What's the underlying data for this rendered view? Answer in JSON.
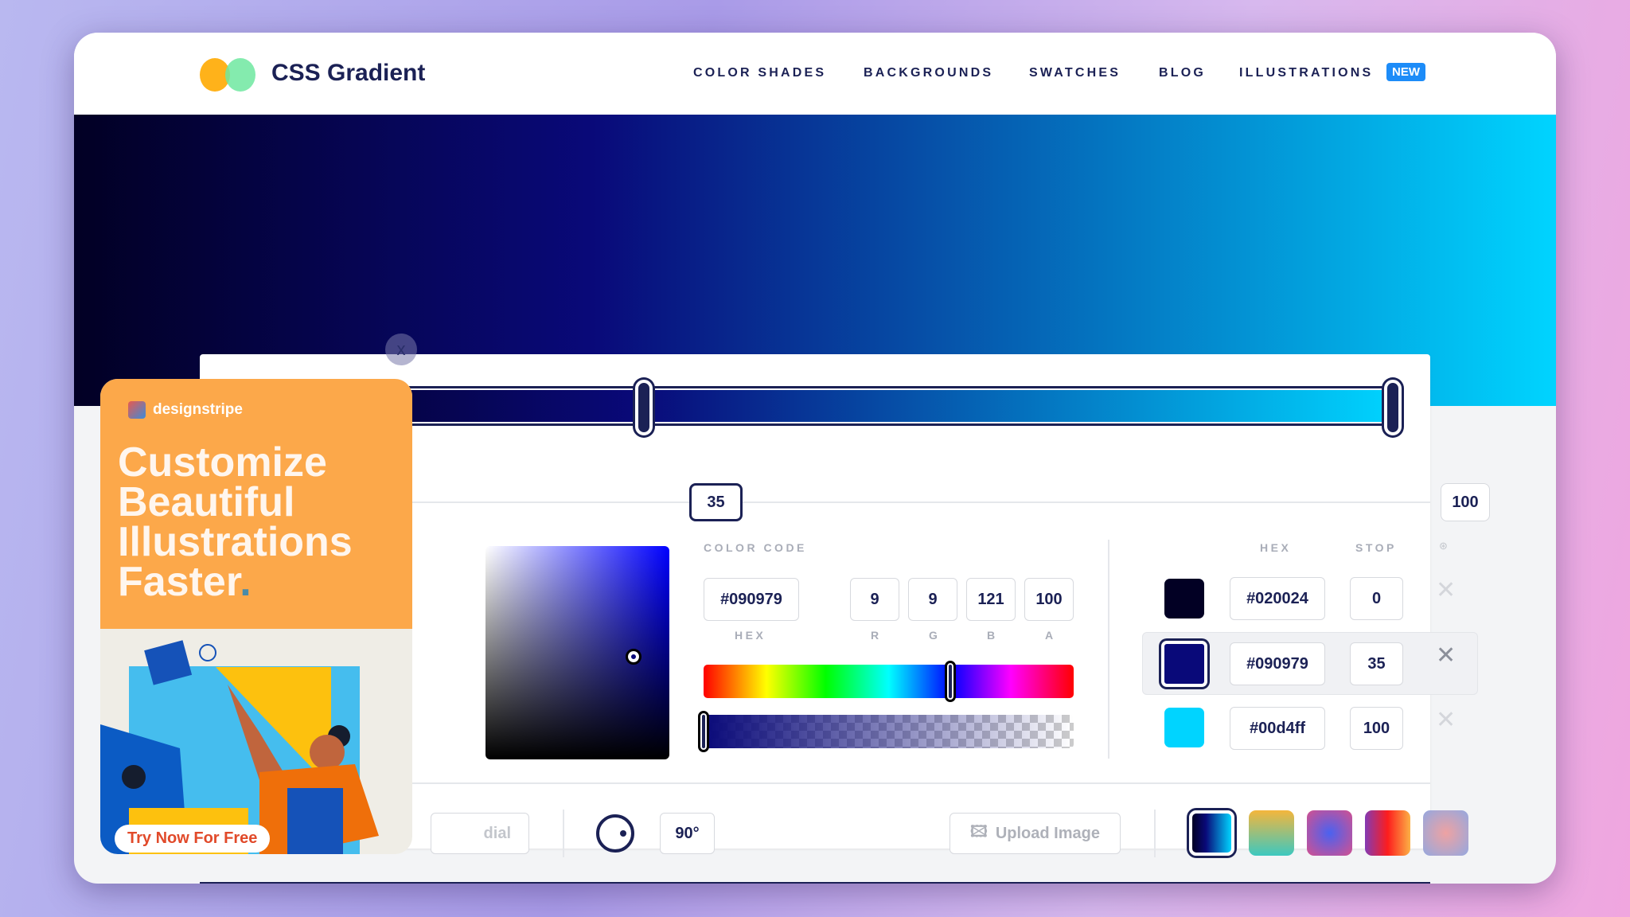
{
  "header": {
    "brand": "CSS Gradient",
    "nav": [
      "COLOR SHADES",
      "BACKGROUNDS",
      "SWATCHES",
      "BLOG",
      "ILLUSTRATIONS"
    ],
    "badge": "NEW"
  },
  "gradient": {
    "colors": [
      "#020024",
      "#090979",
      "#00d4ff"
    ],
    "stops": [
      0,
      35,
      100
    ],
    "stop_labels": [
      "35",
      "100"
    ],
    "angle": "90°"
  },
  "editor": {
    "color_code_label": "COLOR CODE",
    "hex": "#090979",
    "r": "9",
    "g": "9",
    "b": "121",
    "a": "100",
    "labels": {
      "hex": "HEX",
      "r": "R",
      "g": "G",
      "b": "B",
      "a": "A"
    },
    "hue_level": 0.67,
    "alpha_level": 1.0
  },
  "stops_table": {
    "headers": {
      "hex": "HEX",
      "stop": "STOP"
    },
    "rows": [
      {
        "color": "#020024",
        "hex": "#020024",
        "stop": "0"
      },
      {
        "color": "#090979",
        "hex": "#090979",
        "stop": "35",
        "selected": true
      },
      {
        "color": "#00d4ff",
        "hex": "#00d4ff",
        "stop": "100"
      }
    ]
  },
  "toolbar": {
    "radial_label": "dial",
    "angle": "90°",
    "upload_label": "Upload Image"
  },
  "ad": {
    "brand": "designstripe",
    "headline": [
      "Customize",
      "Beautiful",
      "Illustrations",
      "Faster"
    ],
    "cta": "Try Now For Free",
    "close": "x"
  }
}
